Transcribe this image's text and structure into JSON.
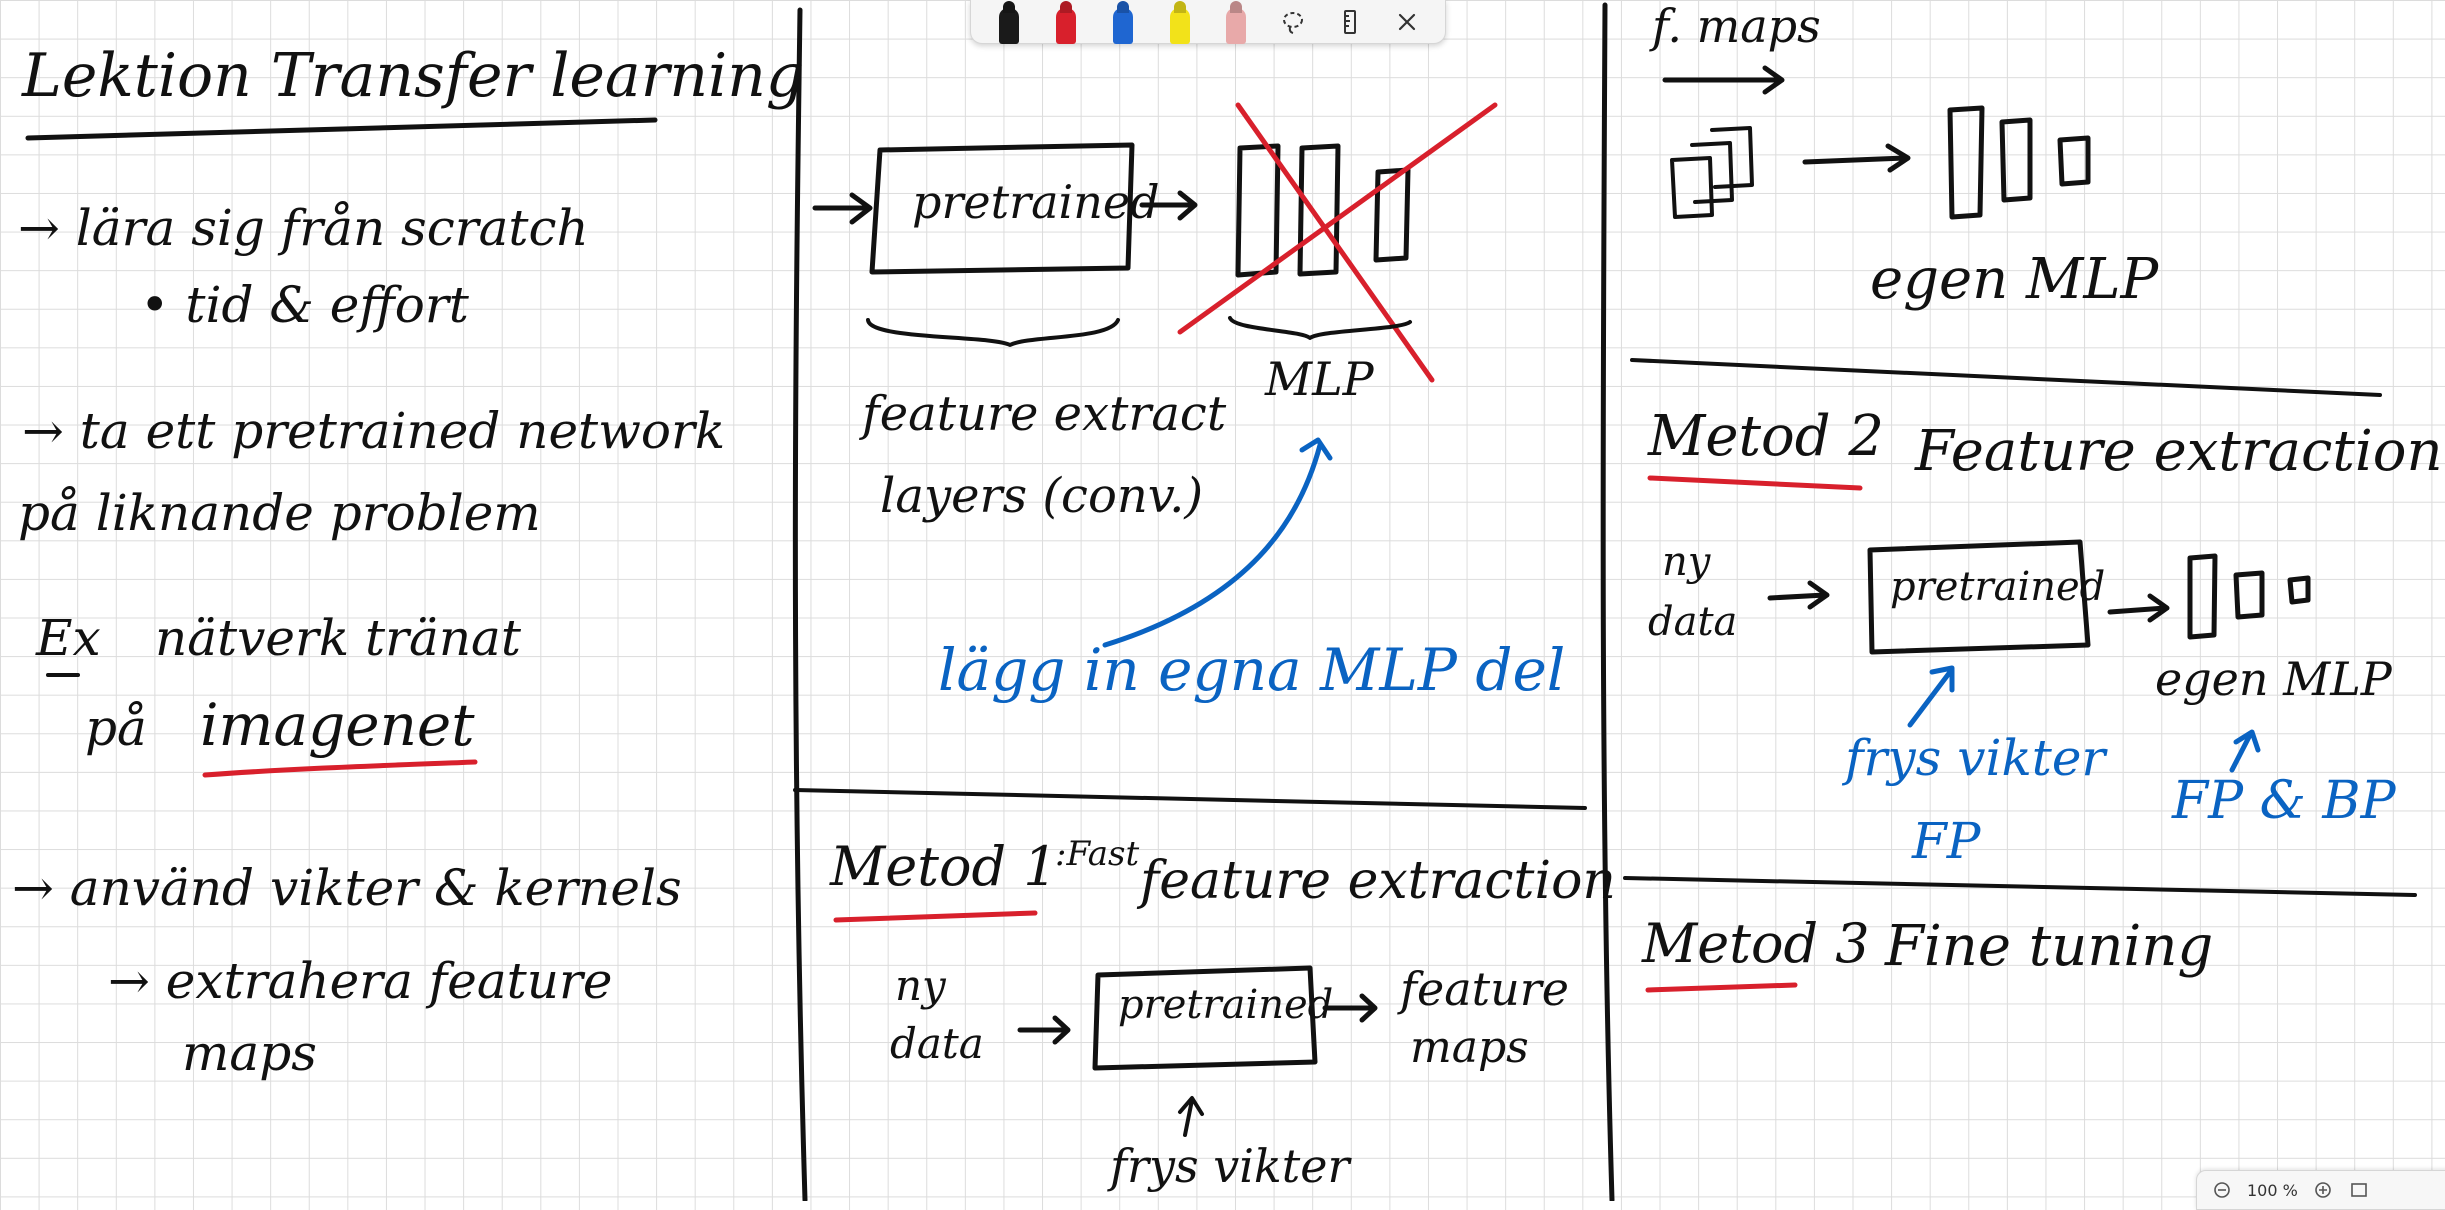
{
  "app": "whiteboard",
  "toolbar": {
    "pens": [
      {
        "name": "black-pen",
        "color": "#1a1a1a"
      },
      {
        "name": "red-pen",
        "color": "#d8202c"
      },
      {
        "name": "blue-pen",
        "color": "#1f66d1"
      },
      {
        "name": "yellow-highlighter",
        "color": "#f2e21a"
      },
      {
        "name": "eraser",
        "color": "#e8a9a9"
      }
    ],
    "icons": [
      "lasso-select-icon",
      "ruler-icon",
      "close-icon"
    ]
  },
  "notes": {
    "col1": {
      "title": "Lektion Transfer learning",
      "line1": "→ lära sig från scratch",
      "line2": "• tid & effort",
      "line3": "→ ta ett pretrained network",
      "line4": "på liknande problem",
      "line5a": "Ex",
      "line5b": "nätverk tränat",
      "line6a": "på",
      "line6b": "imagenet",
      "line7": "→ använd vikter & kernels",
      "line8": "→ extrahera feature",
      "line9": "maps"
    },
    "col2": {
      "pretrained": "pretrained",
      "feature_label_1": "feature extract",
      "feature_label_2": "layers (conv.)",
      "mlp": "MLP",
      "blue_note": "lägg in egna MLP del",
      "metod1": "Metod 1",
      "metod1_sup": ":Fast",
      "metod1_rest": "feature extraction",
      "ny": "ny",
      "data": "data",
      "pretrained2": "pretrained",
      "feature": "feature",
      "maps": "maps",
      "frys": "frys vikter"
    },
    "col3": {
      "fmaps": "f. maps",
      "egen_mlp": "egen MLP",
      "metod2": "Metod 2",
      "metod2_rest": "Feature extraction",
      "ny": "ny",
      "data": "data",
      "pretrained": "pretrained",
      "egen_mlp2": "egen MLP",
      "frys": "frys vikter",
      "fp": "FP",
      "fp_bp": "FP & BP",
      "metod3": "Metod 3",
      "metod3_rest": "Fine tuning"
    }
  },
  "zoom": {
    "level": "100 %"
  }
}
